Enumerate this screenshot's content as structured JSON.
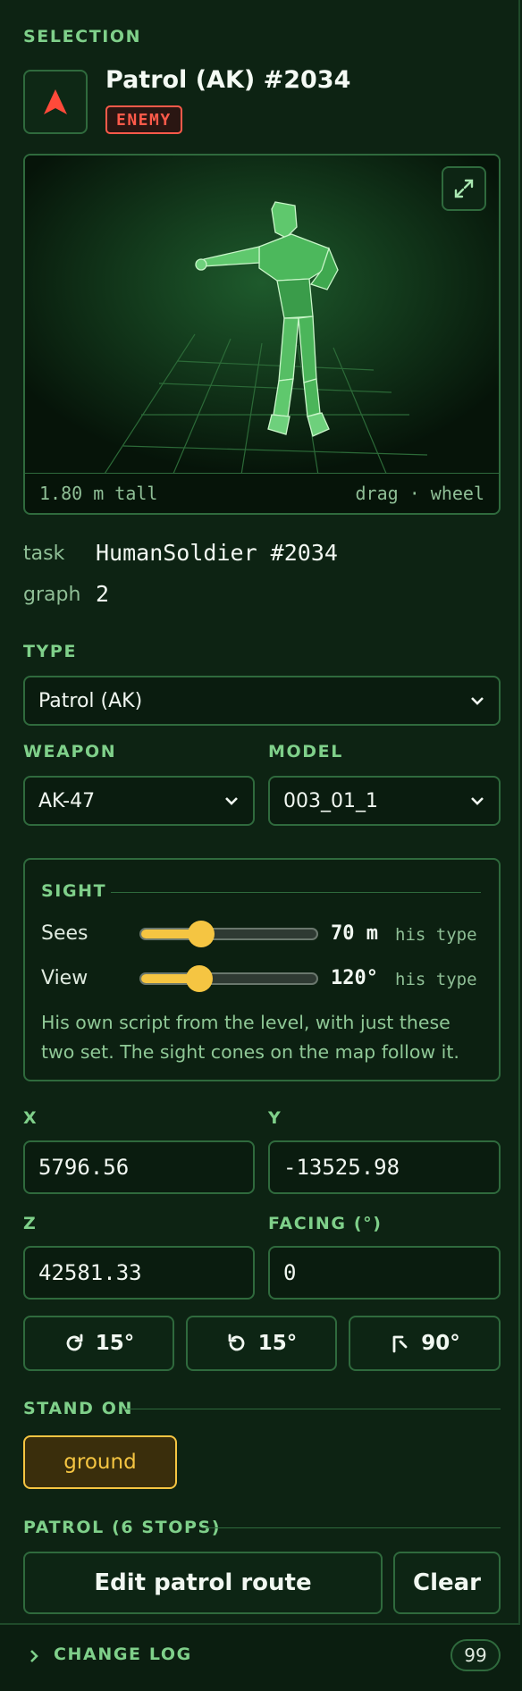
{
  "selection": {
    "header": "SELECTION",
    "name": "Patrol (AK) #2034",
    "badge": "ENEMY",
    "badge_color": "#ff5a4a",
    "icon": "red-arrow-icon"
  },
  "preview": {
    "height_label": "1.80 m tall",
    "hint": "drag · wheel",
    "expand_icon": "expand-icon"
  },
  "info": {
    "task_label": "task",
    "task_value": "HumanSoldier #2034",
    "graph_label": "graph",
    "graph_value": "2"
  },
  "type": {
    "label": "TYPE",
    "value": "Patrol (AK)"
  },
  "weapon": {
    "label": "WEAPON",
    "value": "AK-47"
  },
  "model": {
    "label": "MODEL",
    "value": "003_01_1"
  },
  "sight": {
    "header": "SIGHT",
    "sees_label": "Sees",
    "sees_value": "70 m",
    "sees_fraction": 0.34,
    "sees_note": "his type",
    "view_label": "View",
    "view_value": "120°",
    "view_fraction": 0.33,
    "view_note": "his type",
    "description": "His own script from the level, with just these two set. The sight cones on the map follow it."
  },
  "coords": {
    "x_label": "X",
    "x_value": "5796.56",
    "y_label": "Y",
    "y_value": "-13525.98",
    "z_label": "Z",
    "z_value": "42581.33",
    "facing_label": "FACING (°)",
    "facing_value": "0"
  },
  "rotate": {
    "cw_label": "15°",
    "ccw_label": "15°",
    "corner_label": "90°"
  },
  "stand_on": {
    "header": "STAND ON",
    "option": "ground"
  },
  "patrol": {
    "header": "PATROL (6 STOPS)",
    "edit_label": "Edit patrol route",
    "clear_label": "Clear"
  },
  "changelog": {
    "label": "CHANGE LOG",
    "count": "99"
  },
  "colors": {
    "accent": "#7fd08a",
    "background": "#0d2313",
    "yellow": "#f5c542",
    "enemy": "#ff5a4a"
  }
}
